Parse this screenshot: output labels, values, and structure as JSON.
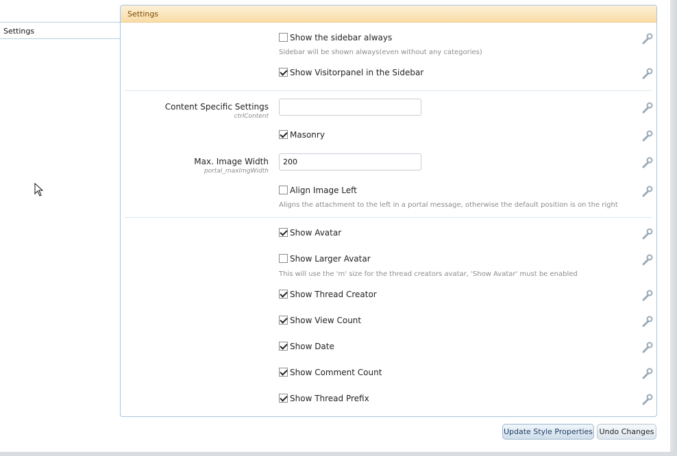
{
  "sidebar": {
    "tab_label": "Settings"
  },
  "panel": {
    "title": "Settings"
  },
  "settings": {
    "show_sidebar_always": {
      "label": "Show the sidebar always",
      "checked": false,
      "hint": "Sidebar will be shown always(even without any categories)"
    },
    "show_visitorpanel": {
      "label": "Show Visitorpanel in the Sidebar",
      "checked": true
    },
    "content_specific": {
      "label": "Content Specific Settings",
      "sub": "ctrlContent",
      "value": ""
    },
    "masonry": {
      "label": "Masonry",
      "checked": true
    },
    "max_image_width": {
      "label": "Max. Image Width",
      "sub": "portal_maxImgWidth",
      "value": "200"
    },
    "align_image_left": {
      "label": "Align Image Left",
      "checked": false,
      "hint": "Aligns the attachment to the left in a portal message, otherwise the default position is on the right"
    },
    "show_avatar": {
      "label": "Show Avatar",
      "checked": true
    },
    "show_larger_avatar": {
      "label": "Show Larger Avatar",
      "checked": false,
      "hint": "This will use the 'm' size for the thread creators avatar, 'Show Avatar' must be enabled"
    },
    "show_thread_creator": {
      "label": "Show Thread Creator",
      "checked": true
    },
    "show_view_count": {
      "label": "Show View Count",
      "checked": true
    },
    "show_date": {
      "label": "Show Date",
      "checked": true
    },
    "show_comment_count": {
      "label": "Show Comment Count",
      "checked": true
    },
    "show_thread_prefix": {
      "label": "Show Thread Prefix",
      "checked": true
    }
  },
  "buttons": {
    "update": "Update Style Properties",
    "undo": "Undo Changes"
  },
  "icons": {
    "row_action": "wrench-icon",
    "cursor": "mouse-pointer-icon"
  },
  "colors": {
    "header_bg": "#f9dca6",
    "border": "#a9c5da",
    "button_primary": "#cfdeec"
  }
}
